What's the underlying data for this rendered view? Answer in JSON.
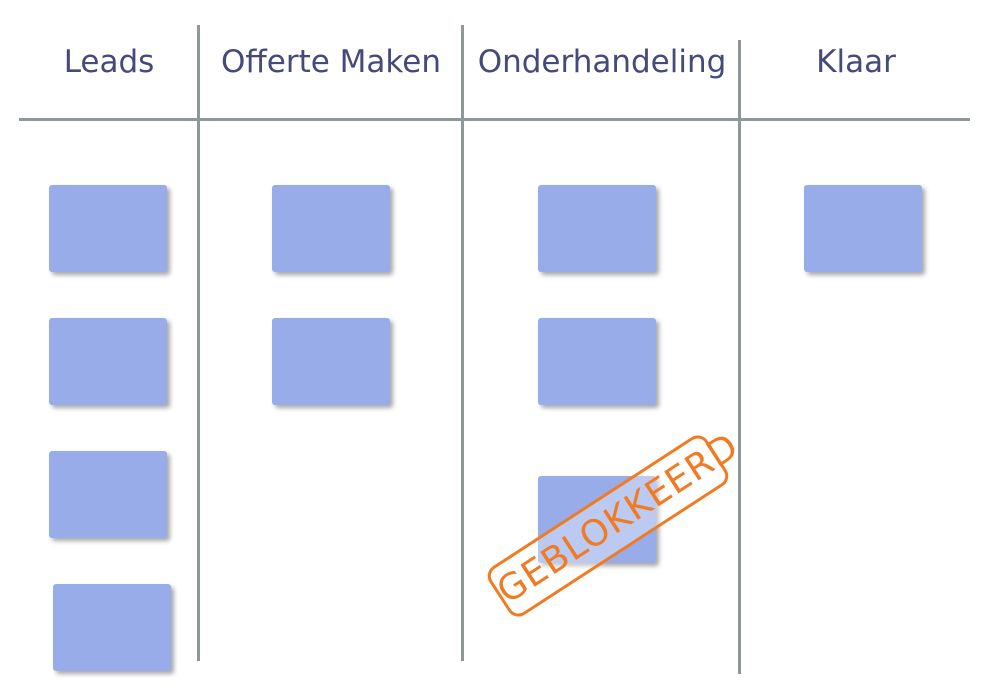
{
  "board": {
    "columns": [
      {
        "title": "Leads",
        "card_count": 4
      },
      {
        "title": "Offerte Maken",
        "card_count": 2
      },
      {
        "title": "Onderhandeling",
        "card_count": 3
      },
      {
        "title": "Klaar",
        "card_count": 1
      }
    ],
    "blocked_stamp": "GEBLOKKEERD"
  },
  "colors": {
    "card": "#98acea",
    "heading": "#454a7a",
    "lines": "#8f979b",
    "stamp": "#f07b22"
  }
}
